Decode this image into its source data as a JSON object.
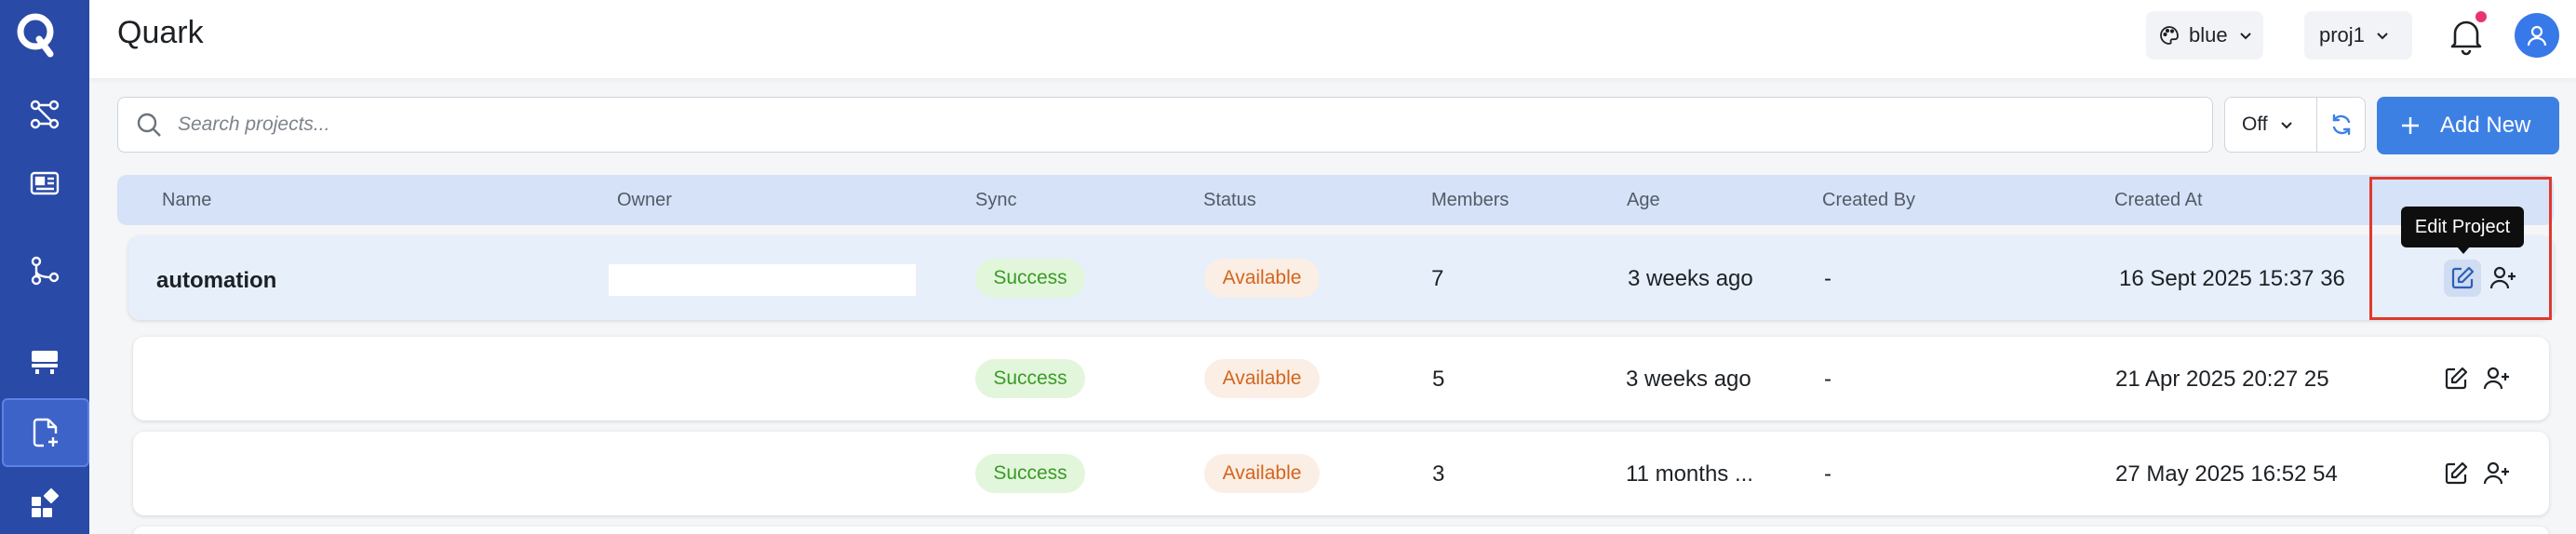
{
  "app": {
    "title": "Quark"
  },
  "sidebar": {
    "items": [
      {
        "icon": "workflow-icon"
      },
      {
        "icon": "dashboard-card-icon"
      },
      {
        "icon": "pipeline-icon"
      },
      {
        "icon": "server-icon"
      },
      {
        "icon": "file-add-icon",
        "active": true
      },
      {
        "icon": "apps-add-icon"
      }
    ]
  },
  "header": {
    "theme_label": "blue",
    "project_label": "proj1",
    "notification_badge": true
  },
  "toolbar": {
    "search_placeholder": "Search projects...",
    "search_value": "",
    "sync_filter": "Off",
    "add_label": "Add New"
  },
  "table": {
    "columns": [
      "Name",
      "Owner",
      "Sync",
      "Status",
      "Members",
      "Age",
      "Created By",
      "Created At"
    ],
    "rows": [
      {
        "name": "automation",
        "owner": "",
        "sync": "Success",
        "status": "Available",
        "members": "7",
        "age": "3 weeks ago",
        "created_by": "-",
        "created_at": "16 Sept 2025 15:37 36"
      },
      {
        "name": "",
        "owner": "",
        "sync": "Success",
        "status": "Available",
        "members": "5",
        "age": "3 weeks ago",
        "created_by": "-",
        "created_at": "21 Apr 2025 20:27 25"
      },
      {
        "name": "",
        "owner": "",
        "sync": "Success",
        "status": "Available",
        "members": "3",
        "age": "11 months ...",
        "created_by": "-",
        "created_at": "27 May 2025 16:52 54"
      }
    ]
  },
  "tooltip": {
    "text": "Edit Project"
  },
  "colors": {
    "sidebar": "#2a4aa8",
    "accent": "#3d80e4",
    "success_bg": "#e2f6db",
    "success_text": "#3a9a26",
    "available_bg": "#fbeee4",
    "available_text": "#d3641d",
    "highlight": "#e0392e"
  }
}
